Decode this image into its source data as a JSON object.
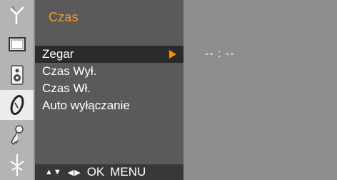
{
  "menu": {
    "title": "Czas",
    "items": [
      {
        "label": "Zegar",
        "selected": true
      },
      {
        "label": "Czas Wył.",
        "selected": false
      },
      {
        "label": "Czas Wł.",
        "selected": false
      },
      {
        "label": "Auto wyłączanie",
        "selected": false
      }
    ],
    "selected_value": "-- : --"
  },
  "sidebar": {
    "icons": [
      "antenna-icon",
      "picture-icon",
      "speaker-icon",
      "clock-icon",
      "key-icon",
      "plug-icon"
    ],
    "selected_index": 3
  },
  "footer": {
    "nav_updown": "▲▼",
    "nav_leftright": "◀▶",
    "ok_label": "OK",
    "menu_label": "MENU"
  },
  "colors": {
    "title": "#f29a2e",
    "arrow": "#ff8c00",
    "panel": "#5a5a5a",
    "selected_row": "#2b2b2b"
  }
}
